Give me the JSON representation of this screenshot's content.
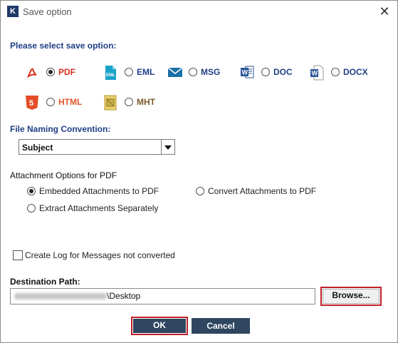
{
  "window": {
    "title": "Save option",
    "app_icon": "K",
    "close": "✕"
  },
  "save_option": {
    "heading": "Please select save option:",
    "selected": "PDF",
    "options": [
      {
        "label": "PDF",
        "icon": "pdf-icon",
        "color": "#d8311d"
      },
      {
        "label": "EML",
        "icon": "eml-icon",
        "color": "#1e3f87"
      },
      {
        "label": "MSG",
        "icon": "msg-icon",
        "color": "#1e3f87"
      },
      {
        "label": "DOC",
        "icon": "doc-icon",
        "color": "#1e3f87"
      },
      {
        "label": "DOCX",
        "icon": "docx-icon",
        "color": "#1e3f87"
      },
      {
        "label": "HTML",
        "icon": "html-icon",
        "color": "#e0572a"
      },
      {
        "label": "MHT",
        "icon": "mht-icon",
        "color": "#7b5a2a"
      }
    ]
  },
  "naming": {
    "heading": "File Naming Convention:",
    "selected": "Subject"
  },
  "attachments": {
    "heading": "Attachment Options for PDF",
    "selected": "Embedded Attachments to PDF",
    "options": [
      "Embedded Attachments to PDF",
      "Convert Attachments to PDF",
      "Extract Attachments Separately"
    ]
  },
  "log": {
    "label": "Create Log for Messages not converted",
    "checked": false
  },
  "destination": {
    "heading": "Destination Path:",
    "path_visible": "\\Desktop",
    "browse_label": "Browse..."
  },
  "buttons": {
    "ok": "OK",
    "cancel": "Cancel"
  },
  "colors": {
    "heading_blue": "#1e3f87",
    "button_navy": "#2f4660",
    "highlight_red": "#c0202a"
  }
}
